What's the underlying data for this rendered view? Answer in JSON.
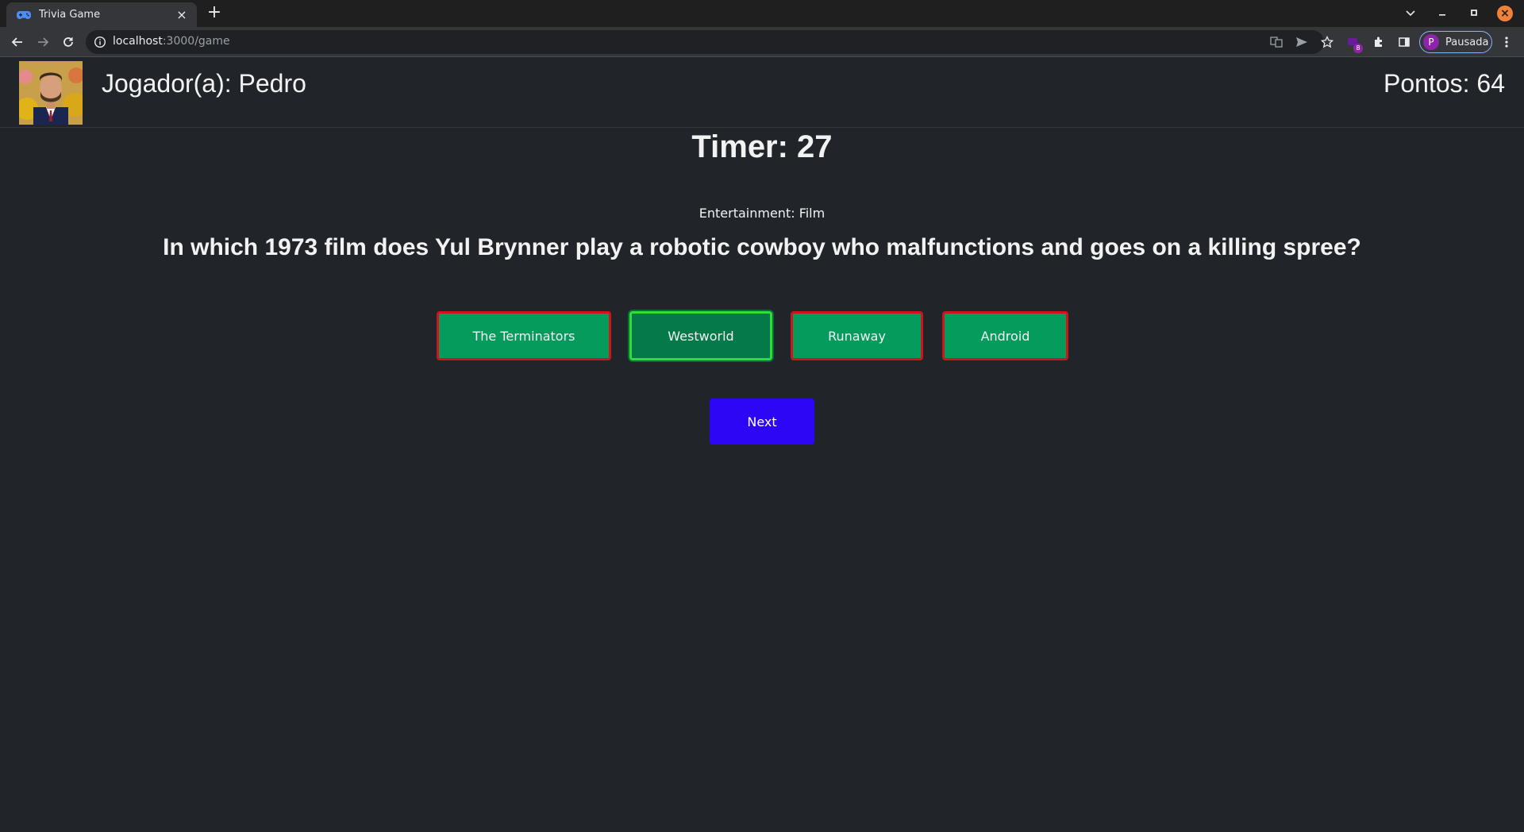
{
  "browser": {
    "tab_title": "Trivia Game",
    "tab_close": "×",
    "new_tab": "+",
    "url_host": "localhost",
    "url_path": ":3000/game",
    "profile_initial": "P",
    "profile_label": "Pausada",
    "extension_badge": "8"
  },
  "header": {
    "player_label": "Jogador(a): Pedro",
    "score_label": "Pontos: 64"
  },
  "game": {
    "timer": "Timer: 27",
    "category": "Entertainment: Film",
    "question": "In which 1973 film does Yul Brynner play a robotic cowboy who malfunctions and goes on a killing spree?",
    "answers": [
      {
        "label": "The Terminators",
        "status": "wrong"
      },
      {
        "label": "Westworld",
        "status": "correct"
      },
      {
        "label": "Runaway",
        "status": "wrong"
      },
      {
        "label": "Android",
        "status": "wrong"
      }
    ],
    "next_label": "Next"
  },
  "colors": {
    "page_bg": "#212529",
    "answer_bg": "#059b5c",
    "wrong_border": "#d0141b",
    "correct_border": "#2dde38",
    "next_bg": "#2c06f5"
  }
}
